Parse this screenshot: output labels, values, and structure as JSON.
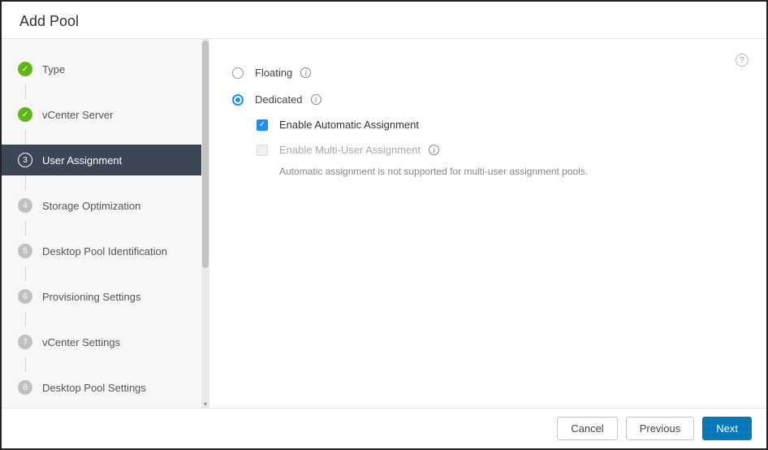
{
  "window": {
    "title": "Add Pool"
  },
  "steps": [
    {
      "label": "Type",
      "state": "done"
    },
    {
      "label": "vCenter Server",
      "state": "done"
    },
    {
      "label": "User Assignment",
      "state": "current",
      "number": "3"
    },
    {
      "label": "Storage Optimization",
      "state": "pending",
      "number": "4"
    },
    {
      "label": "Desktop Pool Identification",
      "state": "pending",
      "number": "5"
    },
    {
      "label": "Provisioning Settings",
      "state": "pending",
      "number": "6"
    },
    {
      "label": "vCenter Settings",
      "state": "pending",
      "number": "7"
    },
    {
      "label": "Desktop Pool Settings",
      "state": "pending",
      "number": "8"
    }
  ],
  "form": {
    "floating_label": "Floating",
    "dedicated_label": "Dedicated",
    "selected": "dedicated",
    "enable_auto_label": "Enable Automatic Assignment",
    "enable_auto_checked": true,
    "enable_multi_label": "Enable Multi-User Assignment",
    "enable_multi_checked": false,
    "enable_multi_disabled": true,
    "multi_hint": "Automatic assignment is not supported for multi-user assignment pools."
  },
  "footer": {
    "cancel": "Cancel",
    "previous": "Previous",
    "next": "Next"
  }
}
